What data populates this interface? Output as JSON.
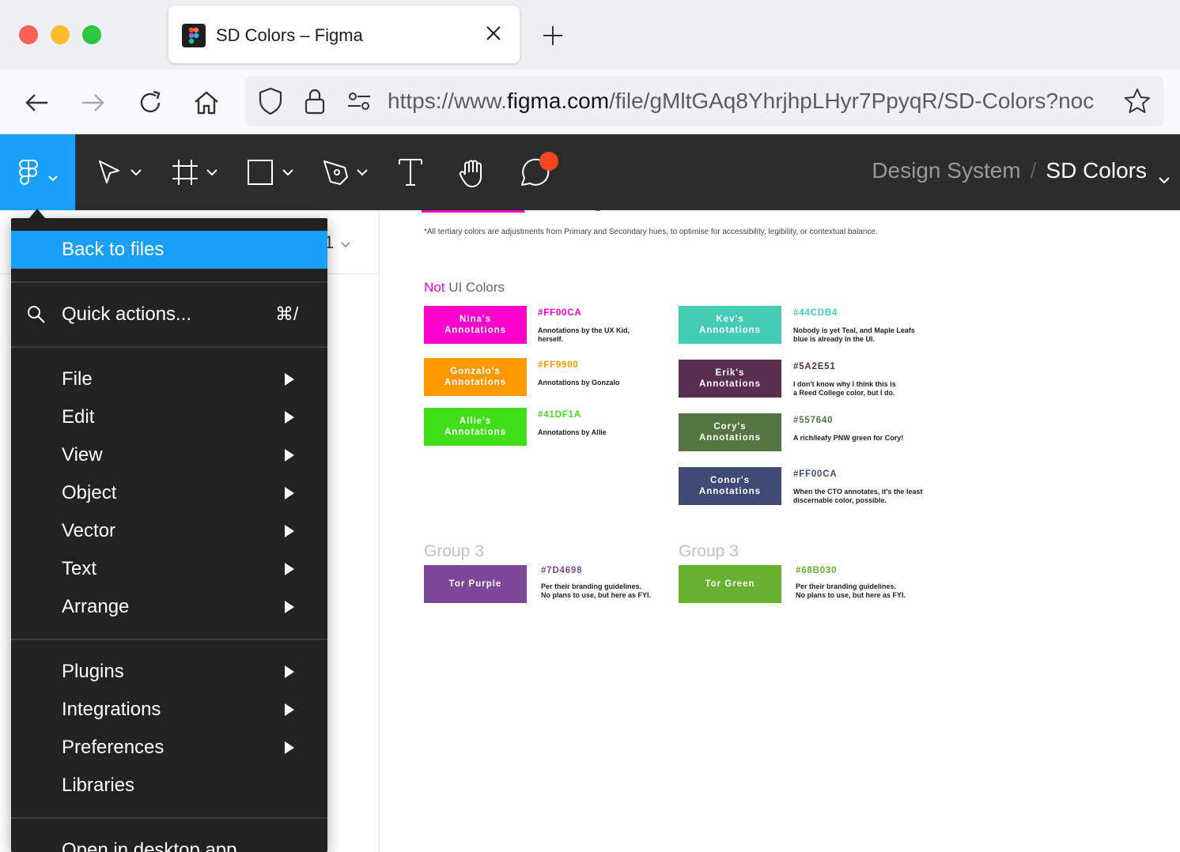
{
  "browser": {
    "tab_title": "SD Colors – Figma",
    "url_prefix": "https://www.",
    "url_host": "figma.com",
    "url_path": "/file/gMltGAq8YhrjhpLHyr7PpyqR/SD-Colors?noc"
  },
  "toolbar": {
    "project": "Design System",
    "separator": "/",
    "file": "SD Colors",
    "brand_color": "#18a0fb",
    "notification_color": "#f24822"
  },
  "left_panel": {
    "page_indicator": "1"
  },
  "menu": {
    "back": "Back to files",
    "quick_actions": "Quick actions...",
    "quick_shortcut": "⌘/",
    "items_a": [
      "File",
      "Edit",
      "View",
      "Object",
      "Vector",
      "Text",
      "Arrange"
    ],
    "items_b": [
      "Plugins",
      "Integrations",
      "Preferences"
    ],
    "libraries": "Libraries",
    "desktop": "Open in desktop app"
  },
  "canvas": {
    "footnote": "*All tertiary colors are adjustments from Primary and Secondary hues, to optimise for accessibility, legibility, or contextual balance.",
    "section_highlight": "Not",
    "section_rest": " UI Colors",
    "swatches": [
      {
        "label1": "Nina's",
        "label2": "Annotations",
        "hex": "#FF00CA",
        "color": "#ff00ca",
        "desc1": "Annotations by the UX Kid,",
        "desc2": "herself."
      },
      {
        "label1": "Gonzalo's",
        "label2": "Annotations",
        "hex": "#FF9900",
        "color": "#ff9900",
        "desc1": "Annotations by Gonzalo",
        "desc2": ""
      },
      {
        "label1": "Allie's",
        "label2": "Annotations",
        "hex": "#41DF1A",
        "color": "#41df1a",
        "desc1": "Annotations by Allie",
        "desc2": ""
      },
      {
        "label1": "Kev's",
        "label2": "Annotations",
        "hex": "#44CDB4",
        "color": "#44cdb4",
        "desc1": "Nobody is yet Teal, and Maple Leafs",
        "desc2": "blue is already in the UI."
      },
      {
        "label1": "Erik's",
        "label2": "Annotations",
        "hex": "#5A2E51",
        "color": "#5a2e51",
        "desc1": "I don't know why I think this is",
        "desc2": "a Reed College color, but I do."
      },
      {
        "label1": "Cory's",
        "label2": "Annotations",
        "hex": "#557640",
        "color": "#557640",
        "desc1": "A rich/leafy PNW green for Cory!",
        "desc2": ""
      },
      {
        "label1": "Conor's",
        "label2": "Annotations",
        "hex": "#FF00CA",
        "color": "#3f4a77",
        "desc1": "When the CTO annotates, it's the least",
        "desc2": "discernable color, possible."
      }
    ],
    "groups": [
      {
        "title": "Group 3",
        "label": "Tor Purple",
        "hex": "#7D4698",
        "color": "#7d4698",
        "desc1": "Per their branding guidelines.",
        "desc2": "No plans to use, but here as FYI."
      },
      {
        "title": "Group 3",
        "label": "Tor Green",
        "hex": "#68B030",
        "color": "#68b030",
        "desc1": "Per their branding guidelines.",
        "desc2": "No plans to use, but here as FYI."
      }
    ]
  }
}
